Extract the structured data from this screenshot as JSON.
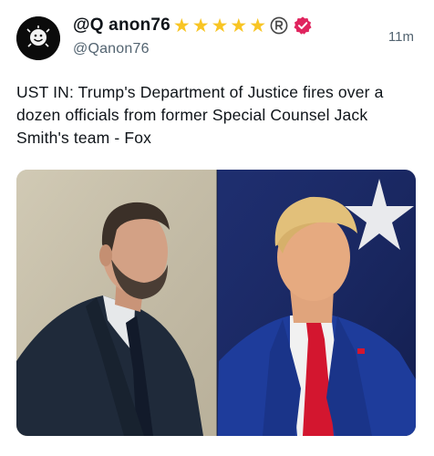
{
  "post": {
    "display_name": "@Q anon76",
    "handle": "@Qanon76",
    "timestamp": "11m",
    "text": "UST IN: Trump's Department of Justice fires over a dozen officials from former Special Counsel Jack Smith's team - Fox",
    "stars": [
      "★",
      "★",
      "★",
      "★",
      "★"
    ],
    "star_color": "#f8c524",
    "verified_color": "#e0245e",
    "avatar_icon": "smiley-avatar-icon",
    "media": {
      "left_photo": "man-in-suit-photo",
      "right_photo": "man-with-flag-photo"
    }
  }
}
